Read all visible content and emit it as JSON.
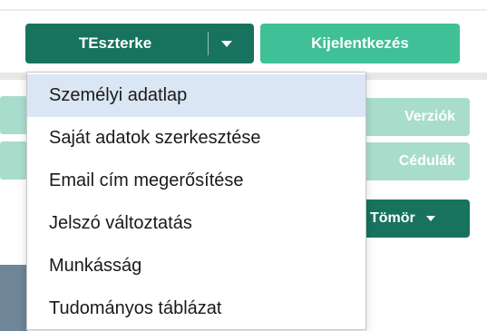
{
  "header": {
    "user_button_label": "TEszterke",
    "logout_label": "Kijelentkezés"
  },
  "dropdown": {
    "items": [
      {
        "label": "Személyi adatlap"
      },
      {
        "label": "Saját adatok szerkesztése"
      },
      {
        "label": "Email cím megerősítése"
      },
      {
        "label": "Jelszó változtatás"
      },
      {
        "label": "Munkásság"
      },
      {
        "label": "Tudományos táblázat"
      }
    ],
    "active_index": 0
  },
  "background": {
    "verziok_label": "Verziók",
    "cedulak_label": "Cédulák",
    "tomor_label": "Tömör"
  },
  "colors": {
    "primary_dark": "#17735e",
    "primary": "#3fc096",
    "disabled": "#a8ddcc",
    "highlight": "#dbe6f4"
  }
}
